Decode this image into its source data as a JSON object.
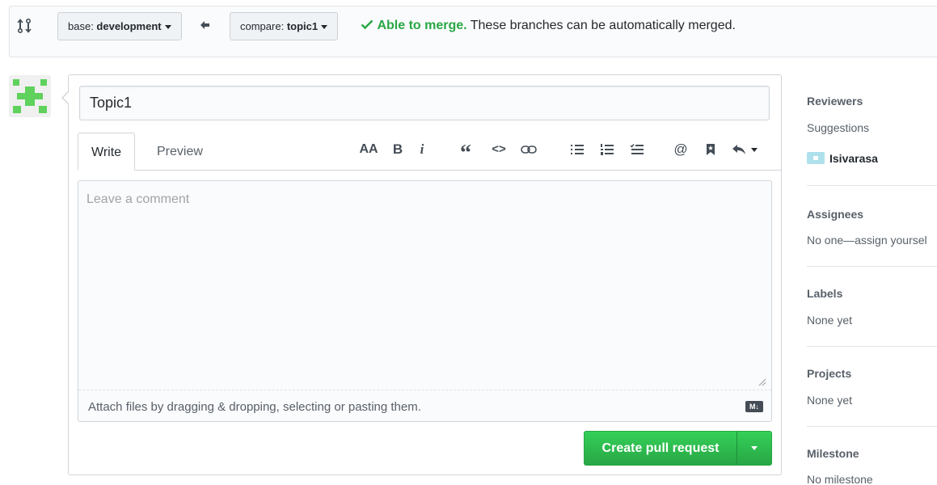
{
  "compare": {
    "base_prefix": "base: ",
    "base_branch": "development",
    "compare_prefix": "compare: ",
    "compare_branch": "topic1",
    "merge_status": "Able to merge.",
    "merge_description": "These branches can be automatically merged."
  },
  "form": {
    "title_value": "Topic1",
    "tabs": [
      {
        "label": "Write",
        "active": true
      },
      {
        "label": "Preview",
        "active": false
      }
    ],
    "toolbar": {
      "heading": "AA",
      "bold": "B",
      "italic": "i",
      "quote": "“",
      "code": "<>",
      "link": "link-icon",
      "unordered_list": "bulleted-list-icon",
      "ordered_list": "numbered-list-icon",
      "task_list": "task-list-icon",
      "mention": "@",
      "saved_reply": "bookmark-icon",
      "reply": "reply-icon"
    },
    "comment_placeholder": "Leave a comment",
    "attach_text": "Attach files by dragging & dropping, selecting or pasting them.",
    "markdown_badge": "M↓",
    "submit_label": "Create pull request"
  },
  "sidebar": {
    "reviewers": {
      "heading": "Reviewers",
      "suggestions_label": "Suggestions",
      "suggested_user": "Isivarasa"
    },
    "assignees": {
      "heading": "Assignees",
      "value": "No one—assign yoursel"
    },
    "labels": {
      "heading": "Labels",
      "value": "None yet"
    },
    "projects": {
      "heading": "Projects",
      "value": "None yet"
    },
    "milestone": {
      "heading": "Milestone",
      "value": "No milestone"
    }
  },
  "colors": {
    "success": "#28a745",
    "border": "#d1d5da",
    "muted_text": "#586069"
  }
}
